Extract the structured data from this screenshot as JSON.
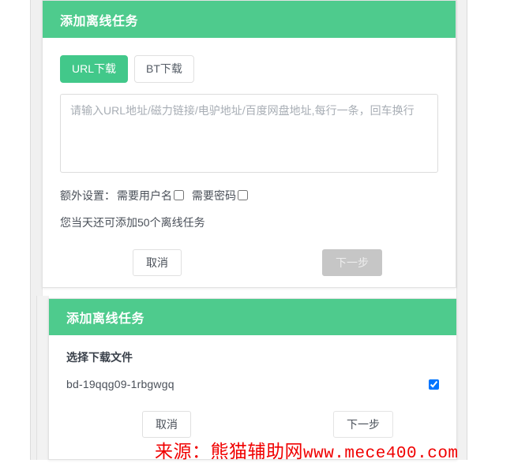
{
  "dialog_url": {
    "title": "添加离线任务",
    "tabs": [
      {
        "label": "URL下载",
        "active": true
      },
      {
        "label": "BT下载",
        "active": false
      }
    ],
    "textarea": {
      "value": "",
      "placeholder": "请输入URL地址/磁力链接/电驴地址/百度网盘地址,每行一条，回车换行"
    },
    "extra": {
      "label": "额外设置：",
      "options": [
        {
          "label": "需要用户名",
          "checked": false
        },
        {
          "label": "需要密码",
          "checked": false
        }
      ]
    },
    "quota_text": "您当天还可添加50个离线任务",
    "buttons": {
      "cancel": "取消",
      "next": "下一步",
      "next_disabled": true
    }
  },
  "dialog_files": {
    "title": "添加离线任务",
    "section_label": "选择下载文件",
    "files": [
      {
        "name": "bd-19qqg09-1rbgwgq",
        "checked": true
      }
    ],
    "buttons": {
      "cancel": "取消",
      "next": "下一步"
    }
  },
  "watermark": {
    "prefix": "来源：熊猫辅助网",
    "url": "www.mece400.com"
  },
  "colors": {
    "header_green": "#4ECB8D",
    "tab_active_green": "#42C88A",
    "disabled_grey": "#c6c6c6",
    "watermark_red": "#f00000"
  }
}
